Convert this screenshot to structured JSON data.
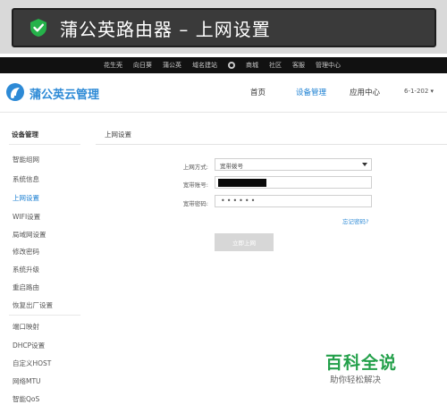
{
  "banner": {
    "title": "蒲公英路由器 – 上网设置",
    "icon": "check-shield-icon"
  },
  "topnav": {
    "items": [
      "花生壳",
      "向日葵",
      "蒲公英",
      "域名建站",
      "",
      "商城",
      "社区",
      "客服",
      "管理中心"
    ]
  },
  "header": {
    "brand": "蒲公英云管理",
    "nav": [
      {
        "label": "首页",
        "active": false
      },
      {
        "label": "设备管理",
        "active": true
      },
      {
        "label": "应用中心",
        "active": false
      }
    ],
    "user": "6-1-202 ▾"
  },
  "sidebar": {
    "title": "设备管理",
    "items": [
      {
        "label": "智能组网",
        "active": false
      },
      {
        "label": "系统信息",
        "active": false
      },
      {
        "label": "上网设置",
        "active": true
      },
      {
        "label": "WIFI设置",
        "active": false
      },
      {
        "label": "局域网设置",
        "active": false
      },
      {
        "label": "修改密码",
        "active": false
      },
      {
        "label": "系统升级",
        "active": false
      },
      {
        "label": "重启路由",
        "active": false
      },
      {
        "label": "恢复出厂设置",
        "active": false
      },
      {
        "label": "端口映射",
        "active": false
      },
      {
        "label": "DHCP设置",
        "active": false
      },
      {
        "label": "自定义HOST",
        "active": false
      },
      {
        "label": "网络MTU",
        "active": false
      },
      {
        "label": "智能QoS",
        "active": false
      }
    ]
  },
  "main": {
    "title": "上网设置",
    "form": {
      "mode_label": "上网方式:",
      "mode_value": "宽带拨号",
      "account_label": "宽带账号:",
      "password_label": "宽带密码:",
      "password_value": "••••••",
      "forgot_link": "忘记密码?",
      "submit_label": "立即上网"
    }
  },
  "watermark": {
    "title": "百科全说",
    "subtitle": "助你轻松解决"
  },
  "colors": {
    "accent": "#1a7fd2",
    "brand": "#2d8ad6",
    "watermark": "#23a04a",
    "banner_bg": "#3a3a3a"
  }
}
